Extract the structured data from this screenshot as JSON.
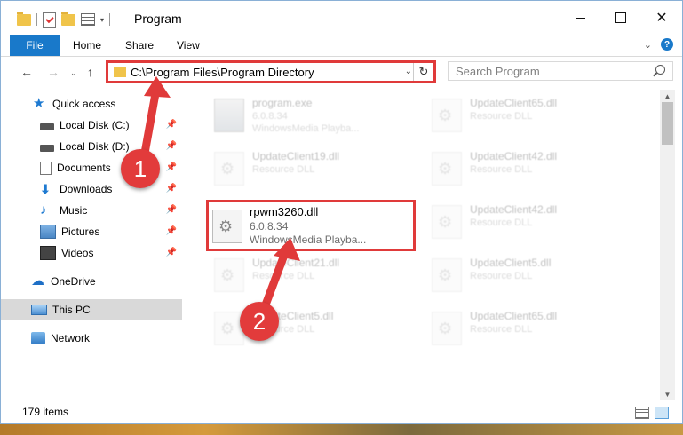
{
  "window": {
    "title": "Program"
  },
  "ribbon": {
    "tabs": [
      "File",
      "Home",
      "Share",
      "View"
    ]
  },
  "address": {
    "path": "C:\\Program Files\\Program Directory"
  },
  "search": {
    "placeholder": "Search Program"
  },
  "sidebar": {
    "items": [
      {
        "label": "Quick access",
        "icon": "star-icon"
      },
      {
        "label": "Local Disk (C:)",
        "icon": "drive-icon",
        "pinned": true
      },
      {
        "label": "Local Disk (D:)",
        "icon": "drive-icon",
        "pinned": true
      },
      {
        "label": "Documents",
        "icon": "documents-icon",
        "pinned": true
      },
      {
        "label": "Downloads",
        "icon": "download-arrow-icon",
        "pinned": true
      },
      {
        "label": "Music",
        "icon": "music-note-icon",
        "pinned": true
      },
      {
        "label": "Pictures",
        "icon": "pictures-icon",
        "pinned": true
      },
      {
        "label": "Videos",
        "icon": "film-icon",
        "pinned": true
      },
      {
        "label": "OneDrive",
        "icon": "cloud-icon"
      },
      {
        "label": "This PC",
        "icon": "computer-icon",
        "selected": true
      },
      {
        "label": "Network",
        "icon": "network-icon"
      }
    ]
  },
  "files": [
    {
      "name": "program.exe",
      "line1": "6.0.8.34",
      "line2": "WindowsMedia Playba..."
    },
    {
      "name": "UpdateClient65.dll",
      "line1": "Resource DLL",
      "line2": ""
    },
    {
      "name": "UpdateClient19.dll",
      "line1": "Resource DLL",
      "line2": ""
    },
    {
      "name": "UpdateClient42.dll",
      "line1": "Resource DLL",
      "line2": ""
    },
    {
      "name": "UpdateClient42.dll",
      "line1": "Resource DLL",
      "line2": ""
    },
    {
      "name": "UpdateClient21.dll",
      "line1": "Resource DLL",
      "line2": ""
    },
    {
      "name": "UpdateClient5.dll",
      "line1": "Resource DLL",
      "line2": ""
    },
    {
      "name": "UpdateClient5.dll",
      "line1": "Resource DLL",
      "line2": ""
    },
    {
      "name": "UpdateClient65.dll",
      "line1": "Resource DLL",
      "line2": ""
    }
  ],
  "highlighted_file": {
    "name": "rpwm3260.dll",
    "line1": "6.0.8.34",
    "line2": "WindowsMedia Playba..."
  },
  "status": {
    "count": "179 items"
  },
  "annotations": {
    "step1": "1",
    "step2": "2",
    "color": "#e03a3a"
  }
}
